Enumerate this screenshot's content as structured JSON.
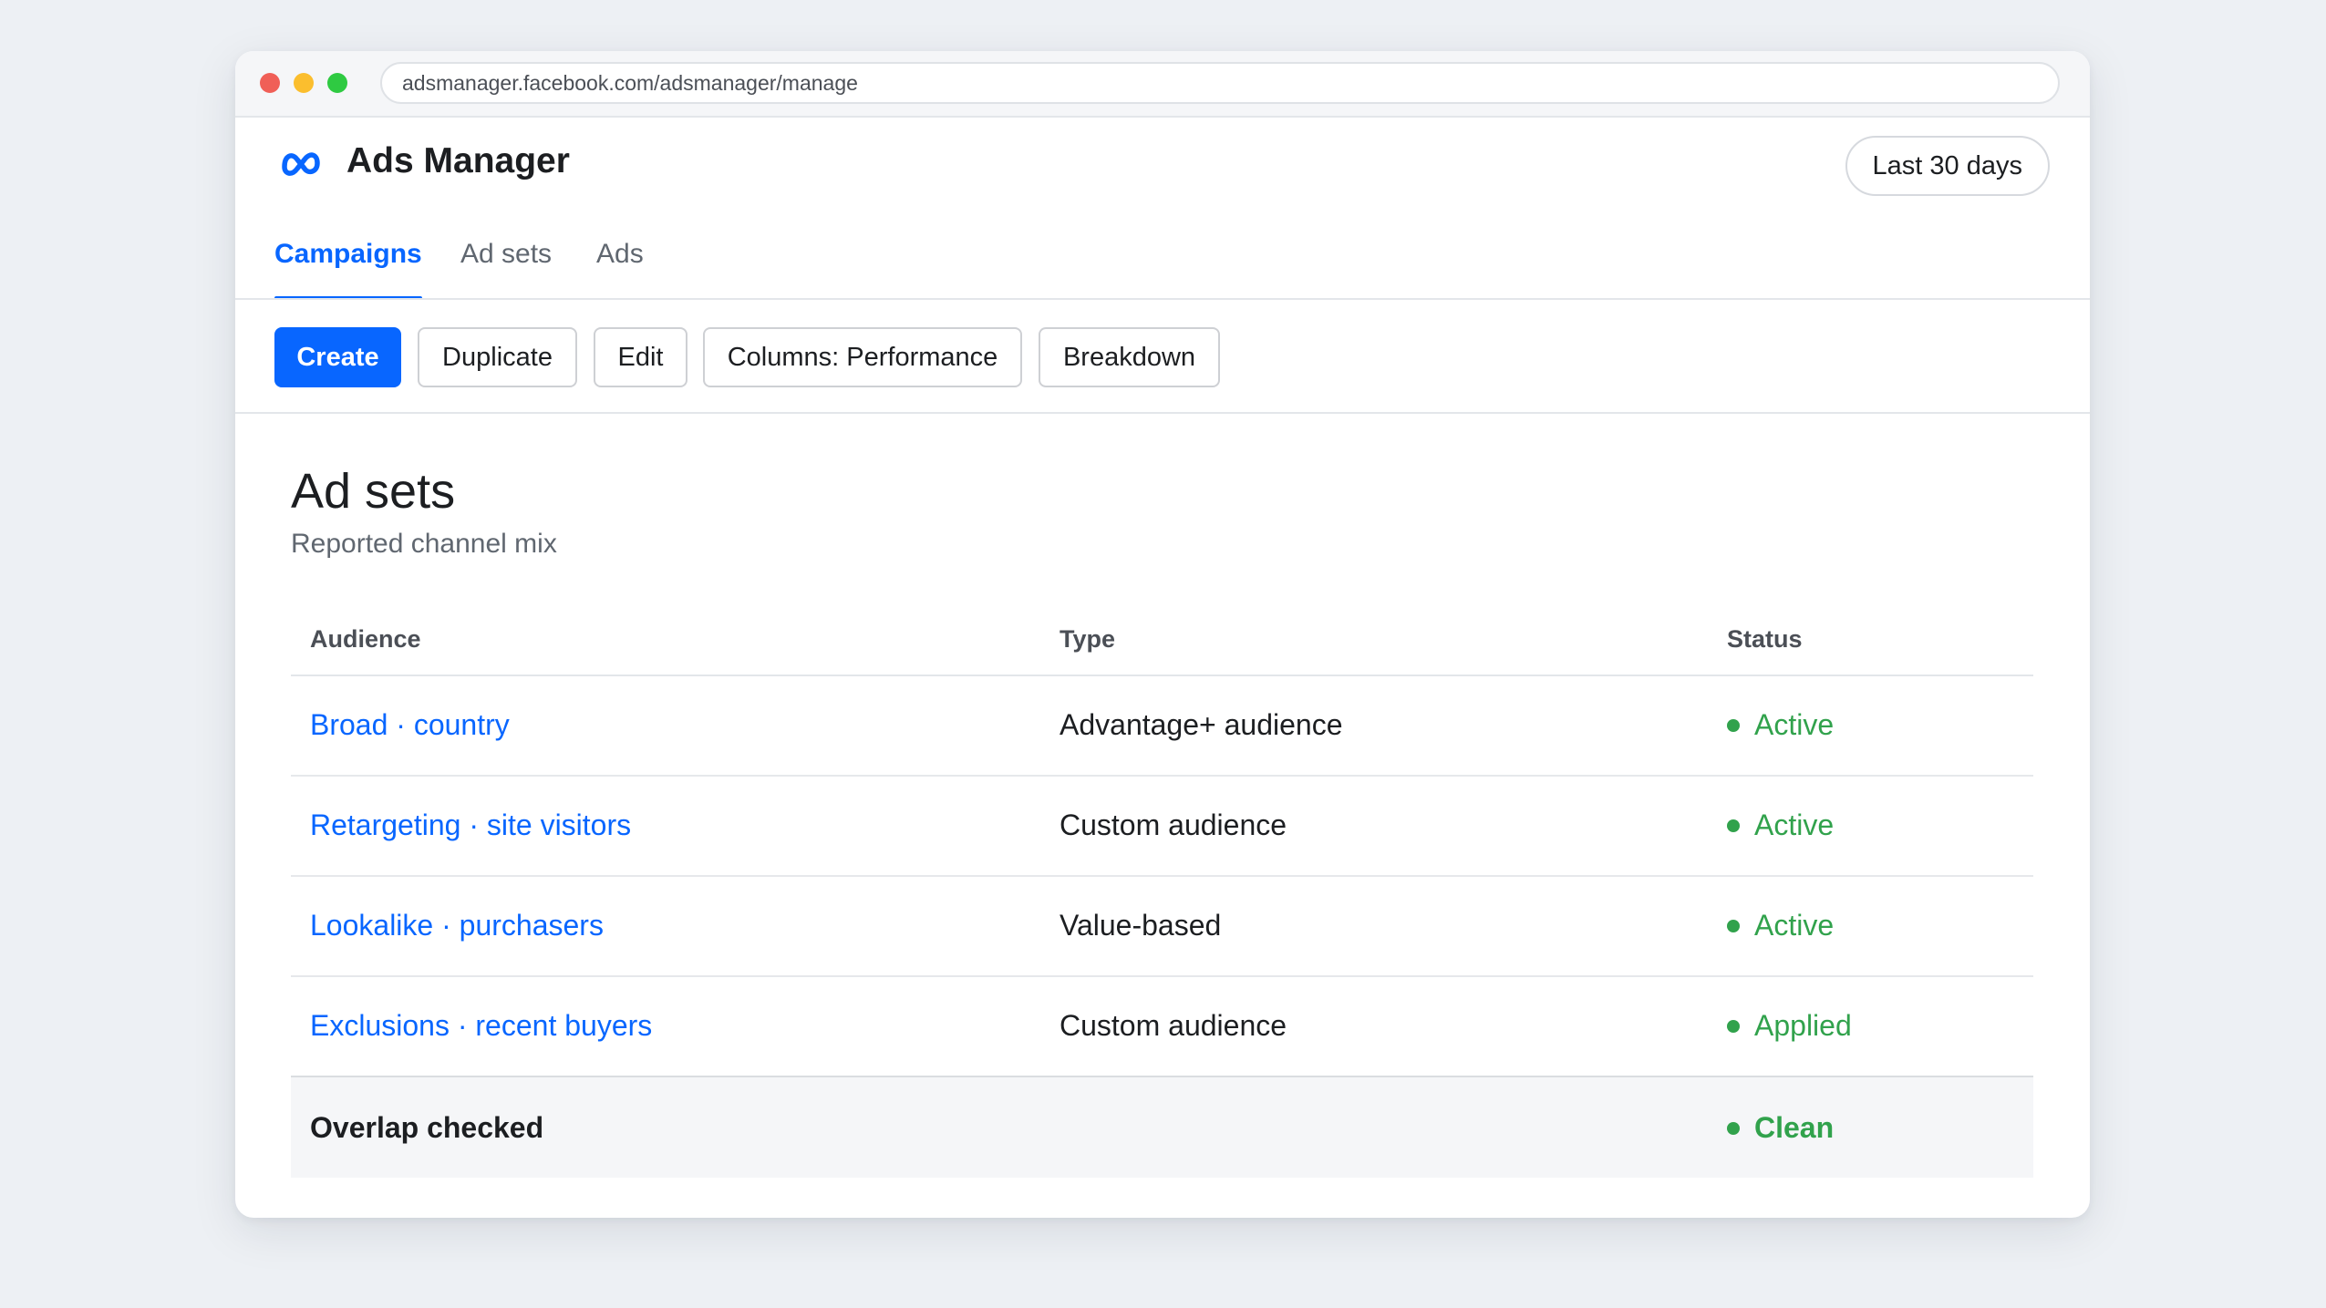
{
  "browser": {
    "url": "adsmanager.facebook.com/adsmanager/manage"
  },
  "header": {
    "logo_icon": "meta-logo-icon",
    "title": "Ads Manager",
    "date_range": "Last 30 days"
  },
  "tabs": [
    {
      "label": "Campaigns",
      "active": true
    },
    {
      "label": "Ad sets",
      "active": false
    },
    {
      "label": "Ads",
      "active": false
    }
  ],
  "toolbar": {
    "create": "Create",
    "duplicate": "Duplicate",
    "edit": "Edit",
    "columns": "Columns: Performance",
    "breakdown": "Breakdown"
  },
  "section": {
    "title": "Ad sets",
    "subtitle": "Reported channel mix"
  },
  "table": {
    "columns": [
      "Audience",
      "Type",
      "Status"
    ],
    "rows": [
      {
        "audience": "Broad · country",
        "type": "Advantage+ audience",
        "status": "Active"
      },
      {
        "audience": "Retargeting · site visitors",
        "type": "Custom audience",
        "status": "Active"
      },
      {
        "audience": "Lookalike · purchasers",
        "type": "Value-based",
        "status": "Active"
      },
      {
        "audience": "Exclusions · recent buyers",
        "type": "Custom audience",
        "status": "Applied"
      }
    ],
    "summary": {
      "label": "Overlap checked",
      "status": "Clean"
    }
  },
  "colors": {
    "accent": "#0866ff",
    "status_green": "#31a24c",
    "text": "#1c1e21",
    "muted": "#606770"
  }
}
